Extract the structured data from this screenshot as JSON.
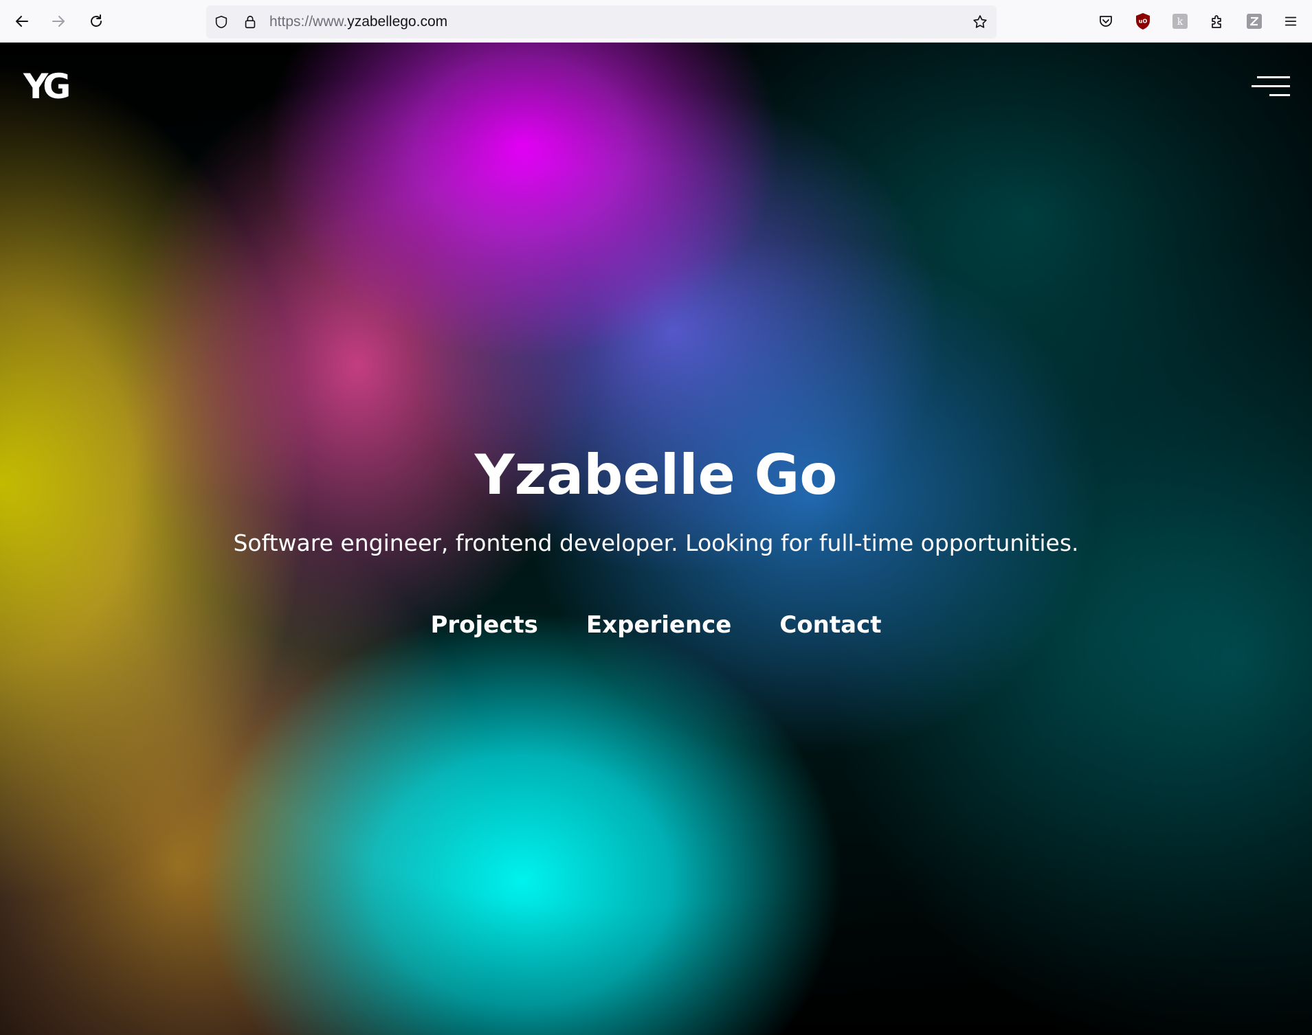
{
  "browser": {
    "url_prefix": "https://www.",
    "url_domain": "yzabellego.com",
    "toolbar_icons": [
      "back-arrow-icon",
      "forward-arrow-icon",
      "reload-icon",
      "shield-icon",
      "lock-icon",
      "bookmark-star-icon",
      "pocket-icon",
      "ublock-origin-icon",
      "extension-k-icon",
      "extensions-puzzle-icon",
      "extension-z-icon",
      "hamburger-menu-icon"
    ]
  },
  "site": {
    "logo": "YG",
    "menu_icon": "hamburger-menu-icon",
    "hero": {
      "title": "Yzabelle Go",
      "subtitle": "Software engineer, frontend developer. Looking for full-time opportunities.",
      "links": [
        "Projects",
        "Experience",
        "Contact"
      ]
    }
  },
  "colors": {
    "accent_magenta": "#eb00ff",
    "accent_cyan": "#00fffa",
    "accent_yellow": "#e1d700",
    "background_dark": "#000000",
    "ublock_red": "#8b0000"
  }
}
